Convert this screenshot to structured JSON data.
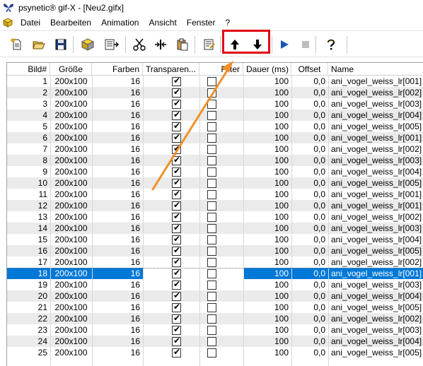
{
  "window": {
    "title": "psynetic® gif-X - [Neu2.gifx]"
  },
  "menu": [
    "Datei",
    "Bearbeiten",
    "Animation",
    "Ansicht",
    "Fenster",
    "?"
  ],
  "toolbar": {
    "buttons": [
      {
        "name": "new-file-icon"
      },
      {
        "name": "open-folder-icon"
      },
      {
        "name": "save-icon"
      },
      {
        "name": "cube-icon"
      },
      {
        "name": "export-icon"
      },
      {
        "name": "cut-icon"
      },
      {
        "name": "split-icon"
      },
      {
        "name": "paste-icon"
      },
      {
        "name": "properties-icon"
      },
      {
        "name": "move-up-icon"
      },
      {
        "name": "move-down-icon"
      },
      {
        "name": "play-icon"
      },
      {
        "name": "stop-icon"
      },
      {
        "name": "help-icon"
      }
    ],
    "highlight_color": "#e30613"
  },
  "columns": [
    "Bild#",
    "Größe",
    "Farben",
    "Transparen...",
    "Filter",
    "Dauer (ms)",
    "Offset",
    "Name"
  ],
  "selected_row": 18,
  "rows": [
    {
      "bild": "1",
      "groesse": "200x100",
      "farben": "16",
      "transparent": true,
      "filter": false,
      "dauer": "100",
      "offset": "0,0",
      "name": "ani_vogel_weiss_lr[001]"
    },
    {
      "bild": "2",
      "groesse": "200x100",
      "farben": "16",
      "transparent": true,
      "filter": false,
      "dauer": "100",
      "offset": "0,0",
      "name": "ani_vogel_weiss_lr[002]"
    },
    {
      "bild": "3",
      "groesse": "200x100",
      "farben": "16",
      "transparent": true,
      "filter": false,
      "dauer": "100",
      "offset": "0,0",
      "name": "ani_vogel_weiss_lr[003]"
    },
    {
      "bild": "4",
      "groesse": "200x100",
      "farben": "16",
      "transparent": true,
      "filter": false,
      "dauer": "100",
      "offset": "0,0",
      "name": "ani_vogel_weiss_lr[004]"
    },
    {
      "bild": "5",
      "groesse": "200x100",
      "farben": "16",
      "transparent": true,
      "filter": false,
      "dauer": "100",
      "offset": "0,0",
      "name": "ani_vogel_weiss_lr[005]"
    },
    {
      "bild": "6",
      "groesse": "200x100",
      "farben": "16",
      "transparent": true,
      "filter": false,
      "dauer": "100",
      "offset": "0,0",
      "name": "ani_vogel_weiss_lr[001]"
    },
    {
      "bild": "7",
      "groesse": "200x100",
      "farben": "16",
      "transparent": true,
      "filter": false,
      "dauer": "100",
      "offset": "0,0",
      "name": "ani_vogel_weiss_lr[002]"
    },
    {
      "bild": "8",
      "groesse": "200x100",
      "farben": "16",
      "transparent": true,
      "filter": false,
      "dauer": "100",
      "offset": "0,0",
      "name": "ani_vogel_weiss_lr[003]"
    },
    {
      "bild": "9",
      "groesse": "200x100",
      "farben": "16",
      "transparent": true,
      "filter": false,
      "dauer": "100",
      "offset": "0,0",
      "name": "ani_vogel_weiss_lr[004]"
    },
    {
      "bild": "10",
      "groesse": "200x100",
      "farben": "16",
      "transparent": true,
      "filter": false,
      "dauer": "100",
      "offset": "0,0",
      "name": "ani_vogel_weiss_lr[005]"
    },
    {
      "bild": "11",
      "groesse": "200x100",
      "farben": "16",
      "transparent": true,
      "filter": false,
      "dauer": "100",
      "offset": "0,0",
      "name": "ani_vogel_weiss_lr[001]"
    },
    {
      "bild": "12",
      "groesse": "200x100",
      "farben": "16",
      "transparent": true,
      "filter": false,
      "dauer": "100",
      "offset": "0,0",
      "name": "ani_vogel_weiss_lr[001]"
    },
    {
      "bild": "13",
      "groesse": "200x100",
      "farben": "16",
      "transparent": true,
      "filter": false,
      "dauer": "100",
      "offset": "0,0",
      "name": "ani_vogel_weiss_lr[002]"
    },
    {
      "bild": "14",
      "groesse": "200x100",
      "farben": "16",
      "transparent": true,
      "filter": false,
      "dauer": "100",
      "offset": "0,0",
      "name": "ani_vogel_weiss_lr[003]"
    },
    {
      "bild": "15",
      "groesse": "200x100",
      "farben": "16",
      "transparent": true,
      "filter": false,
      "dauer": "100",
      "offset": "0,0",
      "name": "ani_vogel_weiss_lr[004]"
    },
    {
      "bild": "16",
      "groesse": "200x100",
      "farben": "16",
      "transparent": true,
      "filter": false,
      "dauer": "100",
      "offset": "0,0",
      "name": "ani_vogel_weiss_lr[005]"
    },
    {
      "bild": "17",
      "groesse": "200x100",
      "farben": "16",
      "transparent": true,
      "filter": false,
      "dauer": "100",
      "offset": "0,0",
      "name": "ani_vogel_weiss_lr[002]"
    },
    {
      "bild": "18",
      "groesse": "200x100",
      "farben": "16",
      "transparent": true,
      "filter": false,
      "dauer": "100",
      "offset": "0,0",
      "name": "ani_vogel_weiss_lr[001]"
    },
    {
      "bild": "19",
      "groesse": "200x100",
      "farben": "16",
      "transparent": true,
      "filter": false,
      "dauer": "100",
      "offset": "0,0",
      "name": "ani_vogel_weiss_lr[003]"
    },
    {
      "bild": "20",
      "groesse": "200x100",
      "farben": "16",
      "transparent": true,
      "filter": false,
      "dauer": "100",
      "offset": "0,0",
      "name": "ani_vogel_weiss_lr[004]"
    },
    {
      "bild": "21",
      "groesse": "200x100",
      "farben": "16",
      "transparent": true,
      "filter": false,
      "dauer": "100",
      "offset": "0,0",
      "name": "ani_vogel_weiss_lr[005]"
    },
    {
      "bild": "22",
      "groesse": "200x100",
      "farben": "16",
      "transparent": true,
      "filter": false,
      "dauer": "100",
      "offset": "0,0",
      "name": "ani_vogel_weiss_lr[002]"
    },
    {
      "bild": "23",
      "groesse": "200x100",
      "farben": "16",
      "transparent": true,
      "filter": false,
      "dauer": "100",
      "offset": "0,0",
      "name": "ani_vogel_weiss_lr[003]"
    },
    {
      "bild": "24",
      "groesse": "200x100",
      "farben": "16",
      "transparent": true,
      "filter": false,
      "dauer": "100",
      "offset": "0,0",
      "name": "ani_vogel_weiss_lr[004]"
    },
    {
      "bild": "25",
      "groesse": "200x100",
      "farben": "16",
      "transparent": true,
      "filter": false,
      "dauer": "100",
      "offset": "0,0",
      "name": "ani_vogel_weiss_lr[005]"
    }
  ],
  "colors": {
    "selection": "#0078d7",
    "alt_row": "#ebebeb",
    "annotation_arrow": "#f0902a"
  }
}
